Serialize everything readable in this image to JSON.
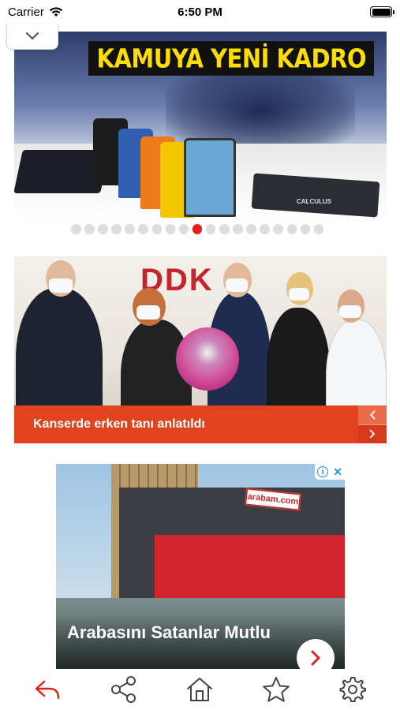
{
  "status_bar": {
    "carrier": "Carrier",
    "time": "6:50 PM",
    "icons": [
      "wifi-icon",
      "battery-icon"
    ]
  },
  "collapse": {
    "icon": "chevron-down-icon"
  },
  "slider": {
    "headline": "KAMUYA YENİ KADRO",
    "calculator_label": "CALCULUS",
    "dots_total": 19,
    "active_index": 9,
    "colors": {
      "active": "#e2231a",
      "inactive": "#dddddd",
      "headline_text": "#ffdd00"
    }
  },
  "news": {
    "caption": "Kanserde erken tanı anlatıldı",
    "photo_sign": "DDK",
    "prev_icon": "chevron-left-icon",
    "next_icon": "chevron-right-icon",
    "colors": {
      "caption_bg": "#e2431f"
    }
  },
  "ad": {
    "title": "Arabasını Satanlar Mutlu",
    "sign_text": "arabam.com",
    "choices": {
      "info_icon": "info-icon",
      "close_icon": "close-icon"
    },
    "cta_icon": "chevron-right-icon"
  },
  "tab_bar": {
    "items": [
      {
        "name": "back",
        "icon": "reply-arrow-icon",
        "color": "#e2231a"
      },
      {
        "name": "share",
        "icon": "share-icon",
        "color": "#444444"
      },
      {
        "name": "home",
        "icon": "home-icon",
        "color": "#444444"
      },
      {
        "name": "favorite",
        "icon": "star-icon",
        "color": "#444444"
      },
      {
        "name": "settings",
        "icon": "gear-icon",
        "color": "#444444"
      }
    ]
  }
}
